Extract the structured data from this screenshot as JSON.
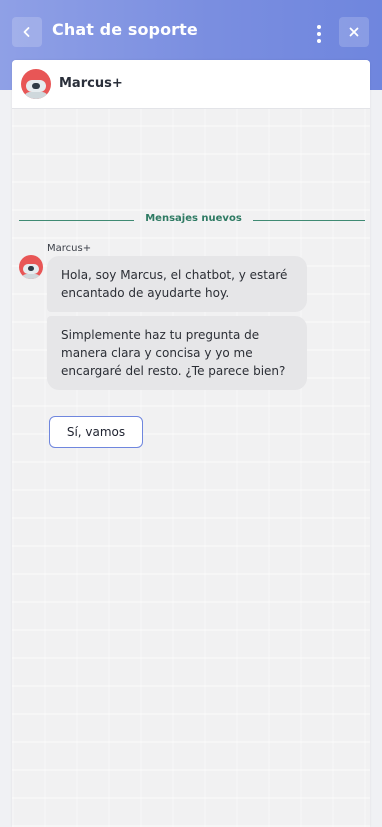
{
  "header": {
    "title": "Chat de soporte",
    "back_icon": "chevron-left-icon",
    "menu_icon": "kebab-menu-icon",
    "close_icon": "close-icon",
    "gradient_colors": [
      "#8fa0e6",
      "#6f86de"
    ]
  },
  "bot": {
    "name": "Marcus+",
    "avatar_icon": "robot-avatar-icon"
  },
  "chat": {
    "divider_label": "Mensajes nuevos",
    "sender": "Marcus+",
    "messages": [
      "Hola, soy Marcus, el chatbot, y estaré encantado de ayudarte hoy.",
      "Simplemente haz tu pregunta de manera clara y concisa y yo me encargaré del resto. ¿Te parece bien?"
    ],
    "quick_reply": "Sí, vamos"
  },
  "colors": {
    "accent": "#6f86de",
    "divider": "#3f8a73",
    "avatar": "#e85656"
  }
}
